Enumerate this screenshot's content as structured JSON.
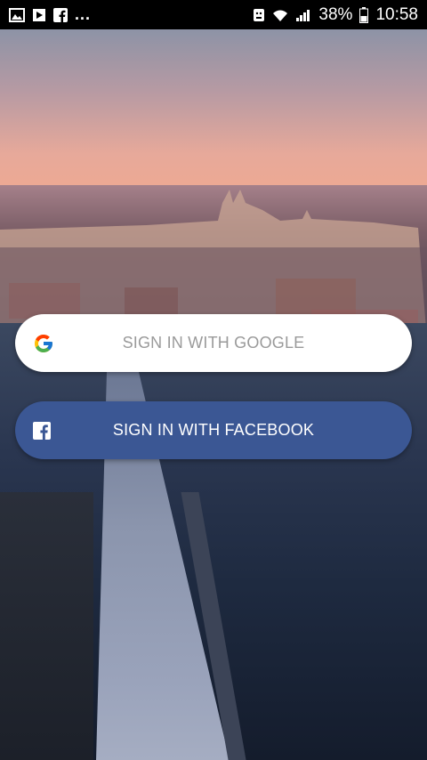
{
  "status_bar": {
    "battery_percent": "38%",
    "time": "10:58",
    "dots": "...",
    "left_icons": [
      "image-icon",
      "play-store-icon",
      "facebook-icon"
    ],
    "right_icons": [
      "android-notification-icon",
      "wifi-icon",
      "signal-icon",
      "battery-icon"
    ]
  },
  "auth": {
    "google_label": "SIGN IN WITH GOOGLE",
    "facebook_label": "SIGN IN WITH FACEBOOK"
  },
  "colors": {
    "facebook_blue": "#3b5794",
    "google_button_bg": "#ffffff",
    "google_text": "#9a9a9a"
  }
}
